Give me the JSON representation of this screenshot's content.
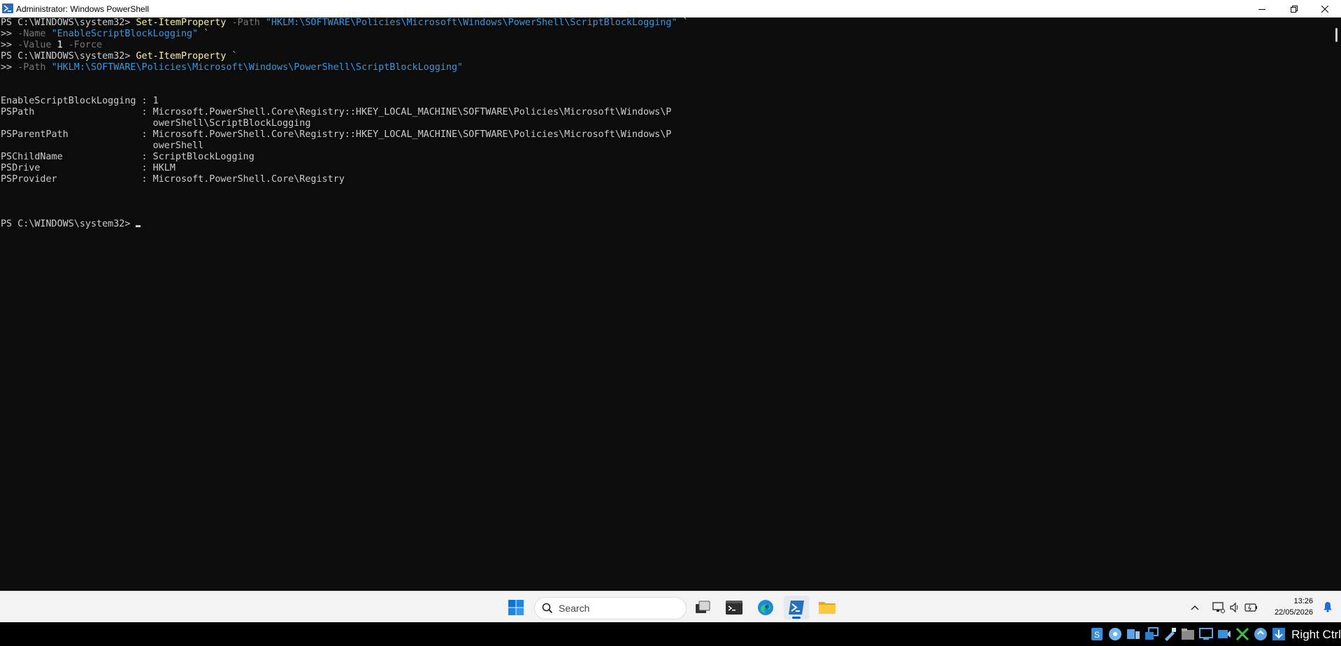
{
  "window": {
    "title": "Administrator: Windows PowerShell"
  },
  "console": {
    "lines": [
      [
        {
          "t": "PS C:\\WINDOWS\\system32> ",
          "c": "prompt"
        },
        {
          "t": "Set-ItemProperty",
          "c": "cmd"
        },
        {
          "t": " -Path ",
          "c": "param"
        },
        {
          "t": "\"HKLM:\\SOFTWARE\\Policies\\Microsoft\\Windows\\PowerShell\\ScriptBlockLogging\"",
          "c": "str"
        },
        {
          "t": " `",
          "c": "text"
        }
      ],
      [
        {
          "t": ">> ",
          "c": "prompt"
        },
        {
          "t": "-Name ",
          "c": "param"
        },
        {
          "t": "\"EnableScriptBlockLogging\"",
          "c": "str"
        },
        {
          "t": " `",
          "c": "text"
        }
      ],
      [
        {
          "t": ">> ",
          "c": "prompt"
        },
        {
          "t": "-Value ",
          "c": "param"
        },
        {
          "t": "1",
          "c": "num"
        },
        {
          "t": " -Force",
          "c": "param"
        }
      ],
      [
        {
          "t": "PS C:\\WINDOWS\\system32> ",
          "c": "prompt"
        },
        {
          "t": "Get-ItemProperty",
          "c": "cmd"
        },
        {
          "t": " `",
          "c": "text"
        }
      ],
      [
        {
          "t": ">> ",
          "c": "prompt"
        },
        {
          "t": "-Path ",
          "c": "param"
        },
        {
          "t": "\"HKLM:\\SOFTWARE\\Policies\\Microsoft\\Windows\\PowerShell\\ScriptBlockLogging\"",
          "c": "str"
        }
      ],
      [],
      [],
      [
        {
          "t": "EnableScriptBlockLogging : 1",
          "c": "text"
        }
      ],
      [
        {
          "t": "PSPath                   : Microsoft.PowerShell.Core\\Registry::HKEY_LOCAL_MACHINE\\SOFTWARE\\Policies\\Microsoft\\Windows\\P",
          "c": "text"
        }
      ],
      [
        {
          "t": "                           owerShell\\ScriptBlockLogging",
          "c": "text"
        }
      ],
      [
        {
          "t": "PSParentPath             : Microsoft.PowerShell.Core\\Registry::HKEY_LOCAL_MACHINE\\SOFTWARE\\Policies\\Microsoft\\Windows\\P",
          "c": "text"
        }
      ],
      [
        {
          "t": "                           owerShell",
          "c": "text"
        }
      ],
      [
        {
          "t": "PSChildName              : ScriptBlockLogging",
          "c": "text"
        }
      ],
      [
        {
          "t": "PSDrive                  : HKLM",
          "c": "text"
        }
      ],
      [
        {
          "t": "PSProvider               : Microsoft.PowerShell.Core\\Registry",
          "c": "text"
        }
      ],
      [],
      [],
      [],
      [
        {
          "t": "PS C:\\WINDOWS\\system32> ",
          "c": "prompt"
        }
      ]
    ],
    "cursor_line": 18
  },
  "taskbar": {
    "search_label": "Search",
    "apps": [
      {
        "name": "start-button",
        "icon": "windows-logo-icon"
      },
      {
        "name": "task-view-button",
        "icon": "task-view-icon"
      },
      {
        "name": "terminal-app",
        "icon": "terminal-icon"
      },
      {
        "name": "edge-app",
        "icon": "edge-icon"
      },
      {
        "name": "powershell-app",
        "icon": "powershell-icon",
        "active": true
      },
      {
        "name": "file-explorer-app",
        "icon": "folder-icon"
      }
    ],
    "tray_icons": [
      "chevron-up-icon",
      "network-icon",
      "volume-icon",
      "battery-icon"
    ],
    "clock": {
      "time": "13:26",
      "date": "22/05/2026"
    },
    "notification_icon": "bell-icon"
  },
  "vbox_bar": {
    "icons": [
      "storage-icon",
      "optical-drive-icon",
      "audio-icon",
      "network-adapters-icon",
      "usb-icon",
      "shared-folders-icon",
      "display-icon",
      "recording-icon",
      "mouse-integration-icon",
      "keyboard-icon",
      "download-icon"
    ],
    "host_key": "Right Ctrl"
  },
  "colors": {
    "console_bg": "#0c0c0c",
    "cmd": "#f9f1a5",
    "string": "#3a96dd",
    "param": "#767676",
    "text": "#cccccc",
    "accent": "#005fb8"
  }
}
